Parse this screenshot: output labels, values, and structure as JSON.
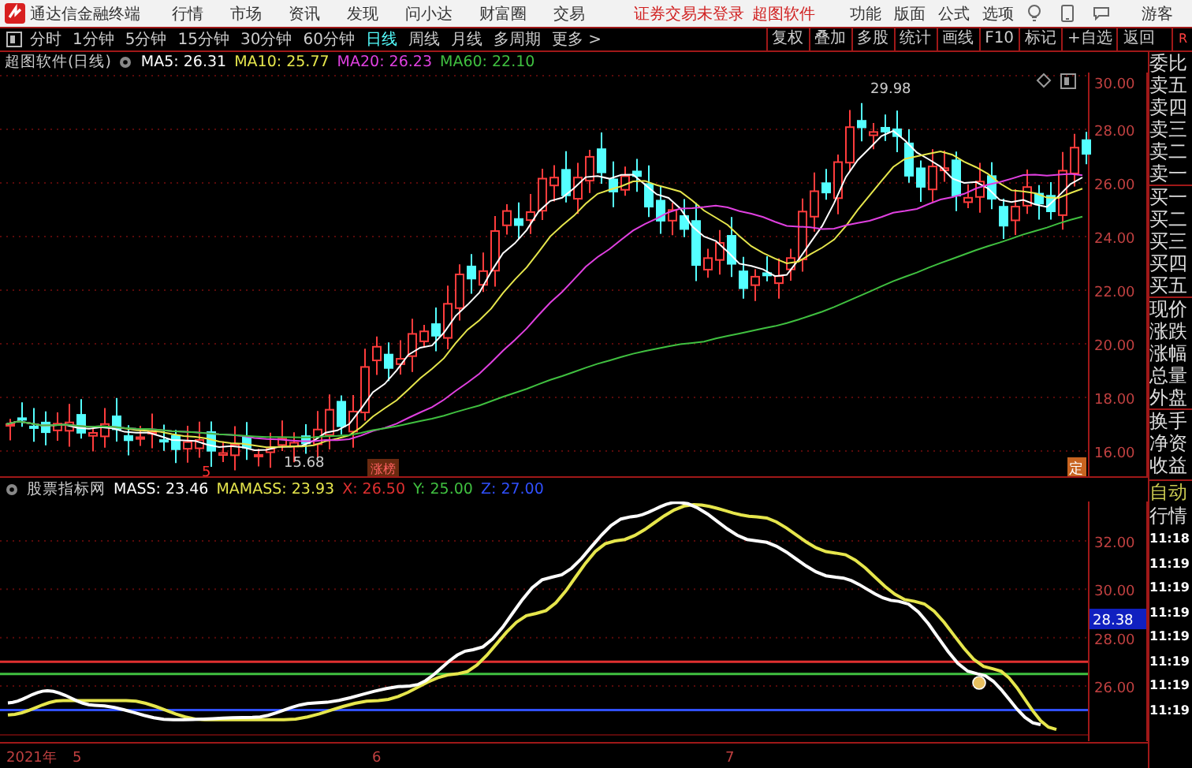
{
  "app_bar": {
    "app_name": "通达信金融终端",
    "menus": [
      "行情",
      "市场",
      "资讯",
      "发现",
      "问小达",
      "财富圈",
      "交易"
    ],
    "login_status": "证券交易未登录",
    "product": "超图软件",
    "tools": [
      "功能",
      "版面",
      "公式",
      "选项"
    ],
    "user": "游客"
  },
  "period_bar": {
    "periods": [
      {
        "label": "分时",
        "selected": false
      },
      {
        "label": "1分钟",
        "selected": false
      },
      {
        "label": "5分钟",
        "selected": false
      },
      {
        "label": "15分钟",
        "selected": false
      },
      {
        "label": "30分钟",
        "selected": false
      },
      {
        "label": "60分钟",
        "selected": false
      },
      {
        "label": "日线",
        "selected": true
      },
      {
        "label": "周线",
        "selected": false
      },
      {
        "label": "月线",
        "selected": false
      },
      {
        "label": "多周期",
        "selected": false
      }
    ],
    "more": "更多 >"
  },
  "tool_buttons": [
    "复权",
    "叠加",
    "多股",
    "统计",
    "画线",
    "F10",
    "标记",
    "+自选",
    "返回",
    "R"
  ],
  "price_chart": {
    "title": "超图软件(日线)",
    "indicators": [
      {
        "label": "MA5: 26.31",
        "color": "#ffffff"
      },
      {
        "label": "MA10: 25.77",
        "color": "#e6e64c"
      },
      {
        "label": "MA20: 26.23",
        "color": "#e040e0"
      },
      {
        "label": "MA60: 22.10",
        "color": "#40c040"
      }
    ],
    "high_label": "29.98",
    "low_label": "15.68",
    "event_marker": "5",
    "tag": "涨榜",
    "flag": "定",
    "y_labels": [
      "30.00",
      "28.00",
      "26.00",
      "24.00",
      "22.00",
      "20.00",
      "18.00",
      "16.00"
    ]
  },
  "indicator_chart": {
    "title": "股票指标网",
    "values": [
      {
        "label": "MASS: 23.46",
        "color": "#ffffff"
      },
      {
        "label": "MAMASS: 23.93",
        "color": "#e6e64c"
      },
      {
        "label": "X: 26.50",
        "color": "#e03030"
      },
      {
        "label": "Y: 25.00",
        "color": "#40c040"
      },
      {
        "label": "Z: 27.00",
        "color": "#3050ff"
      }
    ],
    "current_value": "28.38",
    "y_labels": [
      "32.00",
      "30.00",
      "28.00",
      "26.00"
    ]
  },
  "x_axis": [
    "2021年",
    "5",
    "6",
    "7"
  ],
  "quote_panel": {
    "fields": [
      "委比",
      "卖五",
      "卖四",
      "卖三",
      "卖二",
      "卖一",
      "买一",
      "买二",
      "买三",
      "买四",
      "买五",
      "现价",
      "涨跌",
      "涨幅",
      "总量",
      "外盘",
      "换手",
      "净资",
      "收益"
    ],
    "mode": "自动",
    "section": "行情",
    "times": [
      "11:18",
      "11:19",
      "11:19",
      "11:19",
      "11:19",
      "11:19",
      "11:19",
      "11:19"
    ]
  }
}
